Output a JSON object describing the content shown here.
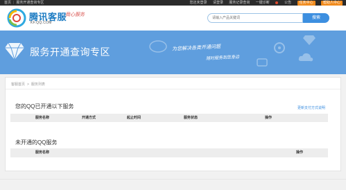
{
  "topbar": {
    "left_items": [
      "首页",
      "服务开通查询专区"
    ],
    "right_items": [
      "您还未登录",
      "请登录",
      "服务记录查询",
      "一键诊断"
    ],
    "public_label": "公告",
    "center_label": "任务中心",
    "consult_label": "帮助人中心"
  },
  "header": {
    "brand": "腾讯客服",
    "brand_sub": "KF.QQ.COM",
    "brand_handwriting": "我心服务",
    "search_placeholder": "请输入产品关键词",
    "search_button": "搜索"
  },
  "banner": {
    "title": "服务开通查询专区",
    "slogan_line1": "为您解决各类开通问题",
    "slogan_line2": "随时服务到您身边"
  },
  "breadcrumb": {
    "home": "客服首页",
    "current": "服务列表"
  },
  "opened": {
    "title": "您的QQ已开通以下服务",
    "help_link": "更新支付方式说明",
    "columns": [
      "服务名称",
      "开通方式",
      "起止时间",
      "服务状态",
      "操作"
    ]
  },
  "not_opened": {
    "title": "未开通的QQ服务",
    "columns": [
      "服务名称",
      "操作"
    ]
  },
  "colors": {
    "banner": "#5f9ede",
    "accent": "#3d8fe0",
    "topbar": "#2b2b2b",
    "orange": "#f08a1c"
  }
}
